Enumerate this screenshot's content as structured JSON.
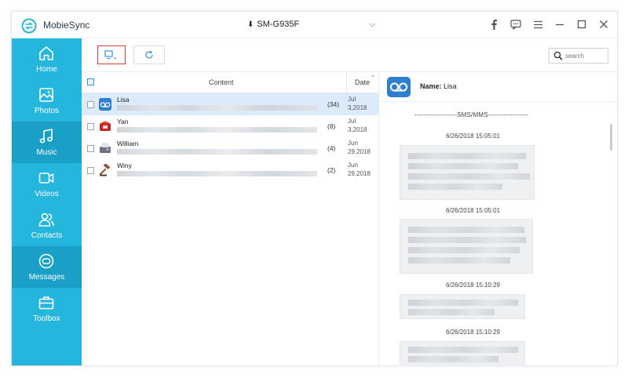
{
  "app": {
    "title": "MobieSync",
    "device": "SM-G935F"
  },
  "titlebar": {
    "icons": [
      "facebook-icon",
      "chat-icon",
      "menu-icon",
      "minimize-icon",
      "maximize-icon",
      "close-icon"
    ]
  },
  "sidebar": {
    "items": [
      {
        "label": "Home",
        "icon": "home-icon",
        "active": false
      },
      {
        "label": "Photos",
        "icon": "photo-icon",
        "active": false
      },
      {
        "label": "Music",
        "icon": "music-icon",
        "active": true
      },
      {
        "label": "Videos",
        "icon": "video-icon",
        "active": false
      },
      {
        "label": "Contacts",
        "icon": "contacts-icon",
        "active": false
      },
      {
        "label": "Messages",
        "icon": "messages-icon",
        "active": true
      },
      {
        "label": "Toolbox",
        "icon": "toolbox-icon",
        "active": false
      }
    ]
  },
  "search": {
    "placeholder": "search"
  },
  "list": {
    "headers": {
      "content": "Content",
      "date": "Date"
    },
    "rows": [
      {
        "name": "Lisa",
        "count": "(34)",
        "date_line1": "Jul",
        "date_line2": "3,2018"
      },
      {
        "name": "Yan",
        "count": "(8)",
        "date_line1": "Jul",
        "date_line2": "3,2018"
      },
      {
        "name": "William",
        "count": "(4)",
        "date_line1": "Jun",
        "date_line2": "29,2018"
      },
      {
        "name": "Winy",
        "count": "(2)",
        "date_line1": "Jun",
        "date_line2": "29,2018"
      }
    ]
  },
  "detail": {
    "name_label": "Name:",
    "name_value": "Lisa",
    "section_label": "-------------------SMS/MMS------------------",
    "messages": [
      {
        "time": "6/26/2018 15:05:01"
      },
      {
        "time": "6/26/2018 15:05:01"
      },
      {
        "time": "6/26/2018 15:10:29"
      },
      {
        "time": "6/26/2018 15:10:29"
      }
    ]
  },
  "colors": {
    "sidebar": "#25b6dd",
    "sidebar_active": "#1a9fc7",
    "selected_row": "#dcebfa",
    "export_highlight": "#e53935"
  }
}
